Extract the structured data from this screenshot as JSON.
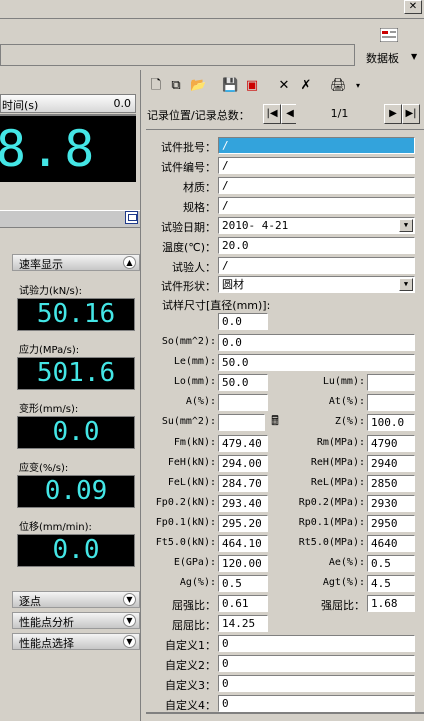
{
  "window": {
    "close_glyph": "✕"
  },
  "data_panel": {
    "label": "数据板",
    "icon": "data-panel-icon"
  },
  "time_display": {
    "label": "时间(s)",
    "small_value": "0.0",
    "value": "8.8"
  },
  "rate": {
    "title": "速率显示",
    "items": [
      {
        "label": "试验力(kN/s):",
        "value": "50.16"
      },
      {
        "label": "应力(MPa/s):",
        "value": "501.6"
      },
      {
        "label": "变形(mm/s):",
        "value": "0.0"
      },
      {
        "label": "应变(%/s):",
        "value": "0.09"
      },
      {
        "label": "位移(mm/min):",
        "value": "0.0"
      }
    ]
  },
  "sections": [
    {
      "title": "逐点"
    },
    {
      "title": "性能点分析"
    },
    {
      "title": "性能点选择"
    }
  ],
  "toolbar": {
    "icons": [
      "new-icon",
      "copy-icon",
      "open-icon",
      "save-icon",
      "export-icon",
      "delete-icon",
      "clear-icon",
      "print-icon"
    ]
  },
  "nav": {
    "label": "记录位置/记录总数：",
    "position": "1/1",
    "first": "|◀",
    "prev": "◀",
    "next": "▶",
    "last": "▶|"
  },
  "form": {
    "batch_no": {
      "label": "试件批号：",
      "value": "/"
    },
    "sample_no": {
      "label": "试件编号：",
      "value": "/"
    },
    "material": {
      "label": "材质：",
      "value": "/"
    },
    "spec": {
      "label": "规格：",
      "value": "/"
    },
    "test_date": {
      "label": "试验日期：",
      "value": "2010- 4-21"
    },
    "temperature": {
      "label": "温度(℃)：",
      "value": "20.0"
    },
    "tester": {
      "label": "试验人：",
      "value": "/"
    },
    "shape": {
      "label": "试件形状：",
      "value": "圆材"
    },
    "size": {
      "label": "试样尺寸[直径(mm)]:",
      "value": "0.0"
    },
    "so": {
      "label": "So(mm^2):",
      "value": "0.0"
    },
    "le": {
      "label": "Le(mm):",
      "value": "50.0"
    },
    "lo": {
      "label": "Lo(mm):",
      "value": "50.0"
    },
    "lu": {
      "label": "Lu(mm):",
      "value": ""
    },
    "a": {
      "label": "A(%):",
      "value": ""
    },
    "at": {
      "label": "At(%):",
      "value": ""
    },
    "su": {
      "label": "Su(mm^2):",
      "value": ""
    },
    "z": {
      "label": "Z(%):",
      "value": "100.0"
    },
    "fm": {
      "label": "Fm(kN):",
      "value": "479.40"
    },
    "rm": {
      "label": "Rm(MPa):",
      "value": "4790"
    },
    "feh": {
      "label": "FeH(kN):",
      "value": "294.00"
    },
    "reh": {
      "label": "ReH(MPa):",
      "value": "2940"
    },
    "fel": {
      "label": "FeL(kN):",
      "value": "284.70"
    },
    "rel": {
      "label": "ReL(MPa):",
      "value": "2850"
    },
    "fp02": {
      "label": "Fp0.2(kN):",
      "value": "293.40"
    },
    "rp02": {
      "label": "Rp0.2(MPa):",
      "value": "2930"
    },
    "fp01": {
      "label": "Fp0.1(kN):",
      "value": "295.20"
    },
    "rp01": {
      "label": "Rp0.1(MPa):",
      "value": "2950"
    },
    "ft50": {
      "label": "Ft5.0(kN):",
      "value": "464.10"
    },
    "rt50": {
      "label": "Rt5.0(MPa):",
      "value": "4640"
    },
    "e": {
      "label": "E(GPa):",
      "value": "120.00"
    },
    "ae": {
      "label": "Ae(%):",
      "value": "0.5"
    },
    "ag": {
      "label": "Ag(%):",
      "value": "0.5"
    },
    "agt": {
      "label": "Agt(%):",
      "value": "4.5"
    },
    "yield_strength_ratio": {
      "label": "屈强比：",
      "value": "0.61"
    },
    "strength_yield_ratio": {
      "label": "强屈比：",
      "value": "1.68"
    },
    "yield_ratio": {
      "label": "屈屈比：",
      "value": "14.25"
    },
    "custom1": {
      "label": "自定义1：",
      "value": "0"
    },
    "custom2": {
      "label": "自定义2：",
      "value": "0"
    },
    "custom3": {
      "label": "自定义3：",
      "value": "0"
    },
    "custom4": {
      "label": "自定义4：",
      "value": "0"
    }
  }
}
